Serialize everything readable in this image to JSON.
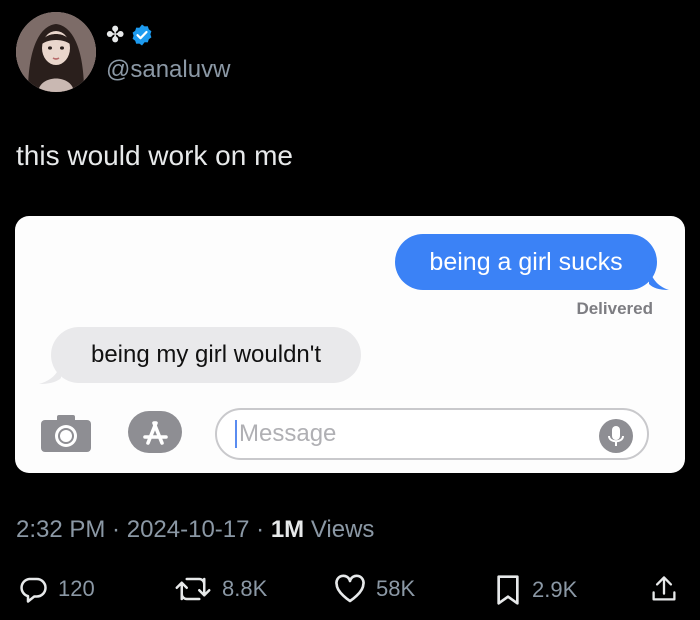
{
  "author": {
    "name_glyph": "✤",
    "handle": "@sanaluvw",
    "verified": true,
    "verified_color": "#1d9bf0"
  },
  "tweet": {
    "text": "this would work on me"
  },
  "conversation": {
    "outgoing": "being a girl sucks",
    "status": "Delivered",
    "incoming": "being my girl wouldn't",
    "input_placeholder": "Message",
    "outgoing_color": "#3b82f6",
    "incoming_color": "#e9e9eb"
  },
  "meta": {
    "time": "2:32 PM",
    "sep1": " · ",
    "date": "2024-10-17",
    "sep2": " · ",
    "views": "1M",
    "views_label": " Views"
  },
  "actions": {
    "replies": "120",
    "reposts": "8.8K",
    "likes": "58K",
    "bookmarks": "2.9K"
  }
}
